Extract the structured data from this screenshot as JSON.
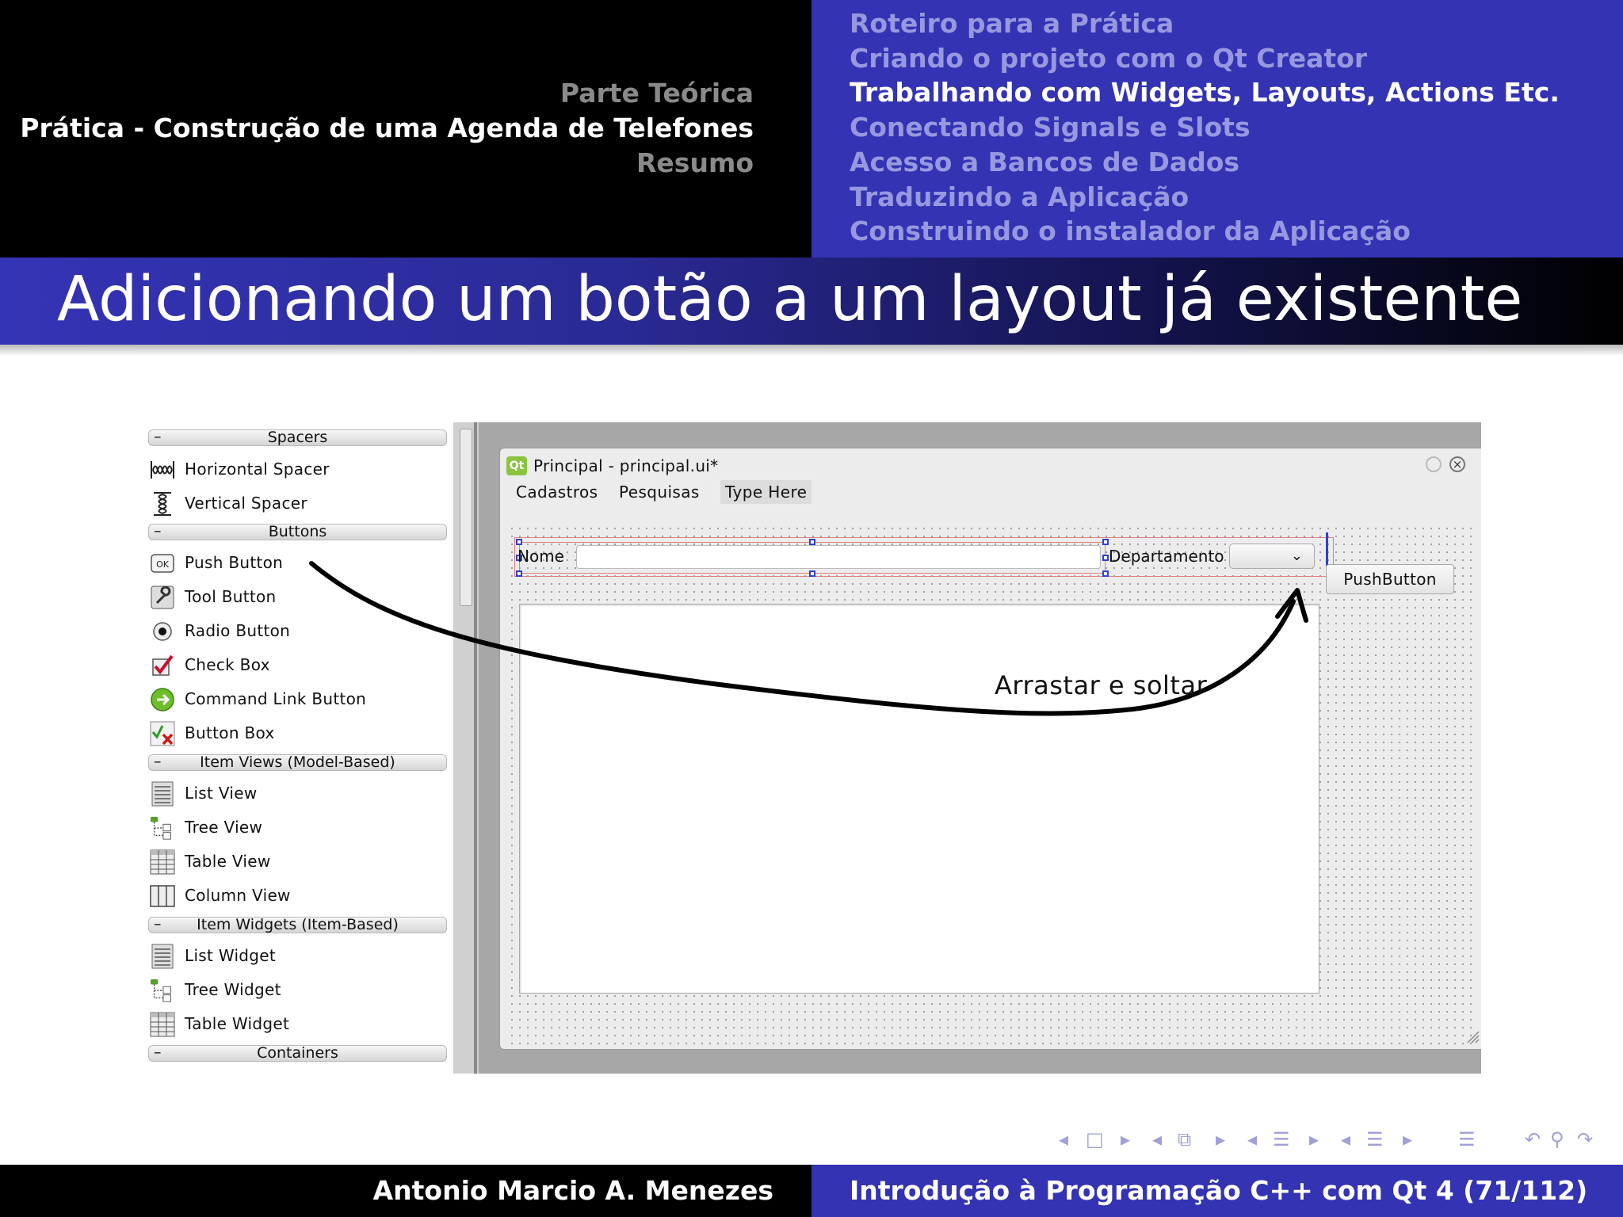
{
  "header": {
    "sections": [
      {
        "label": "Parte Teórica",
        "active": false
      },
      {
        "label": "Prática - Construção de uma Agenda de Telefones",
        "active": true
      },
      {
        "label": "Resumo",
        "active": false
      }
    ],
    "subsections": [
      {
        "label": "Roteiro para a Prática",
        "active": false
      },
      {
        "label": "Criando o projeto com o Qt Creator",
        "active": false
      },
      {
        "label": "Trabalhando com Widgets, Layouts, Actions Etc.",
        "active": true
      },
      {
        "label": "Conectando Signals e Slots",
        "active": false
      },
      {
        "label": "Acesso a Bancos de Dados",
        "active": false
      },
      {
        "label": "Traduzindo a Aplicação",
        "active": false
      },
      {
        "label": "Construindo o instalador da Aplicação",
        "active": false
      }
    ]
  },
  "slide_title": "Adicionando um botão a um layout já existente",
  "widget_box": {
    "categories": {
      "spacers": "Spacers",
      "buttons": "Buttons",
      "item_views": "Item Views (Model-Based)",
      "item_widgets": "Item Widgets (Item-Based)",
      "containers": "Containers"
    },
    "items": {
      "horizontal_spacer": "Horizontal Spacer",
      "vertical_spacer": "Vertical Spacer",
      "push_button": "Push Button",
      "tool_button": "Tool Button",
      "radio_button": "Radio Button",
      "check_box": "Check Box",
      "command_link_button": "Command Link Button",
      "button_box": "Button Box",
      "list_view": "List View",
      "tree_view": "Tree View",
      "table_view": "Table View",
      "column_view": "Column View",
      "list_widget": "List Widget",
      "tree_widget": "Tree Widget",
      "table_widget": "Table Widget"
    },
    "collapse_symbol": "–"
  },
  "form_window": {
    "title": "Principal - principal.ui*",
    "qt_badge": "Qt",
    "menus": [
      "Cadastros",
      "Pesquisas",
      "Type Here"
    ],
    "label_nome": "Nome",
    "label_departamento": "Departamento"
  },
  "dragged_button": "PushButton",
  "annotation": "Arrastar e soltar",
  "footer": {
    "author": "Antonio Marcio A. Menezes",
    "course": "Introdução à Programação C++ com Qt 4 (71/112)"
  },
  "colors": {
    "beamer_blue": "#3333b3",
    "inactive_subsection": "#9898e0",
    "inactive_section": "#8a8a8a",
    "selection_handle": "#3040d0",
    "layout_border": "#e08080"
  }
}
